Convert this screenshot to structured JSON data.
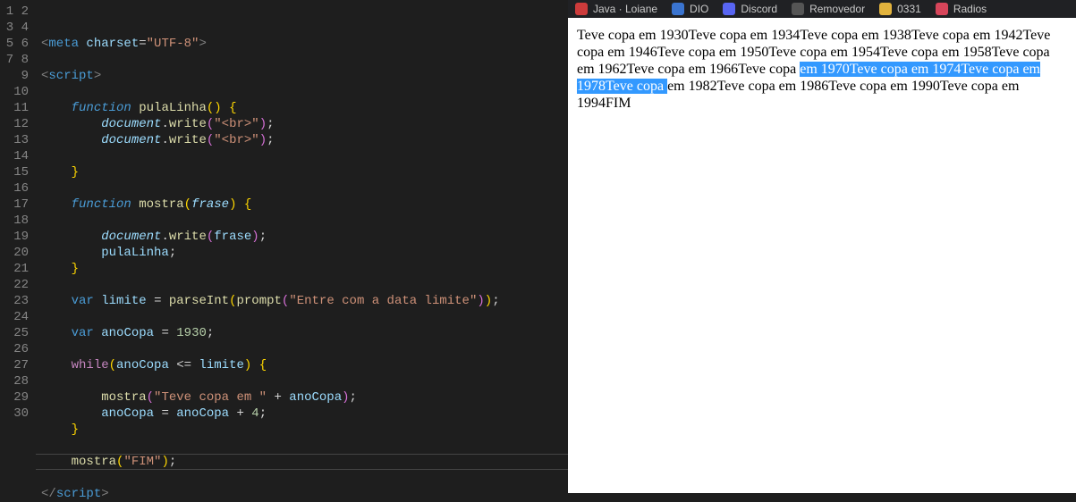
{
  "editor": {
    "line_count": 30,
    "current_line": 29,
    "lines": {
      "l1_meta": "meta",
      "l1_charset": "charset",
      "l1_val": "\"UTF-8\"",
      "l3_script": "script",
      "l5_function": "function",
      "l5_name": "pulaLinha",
      "l6_document": "document",
      "l6_write": "write",
      "l6_str": "\"<br>\"",
      "l7_document": "document",
      "l7_write": "write",
      "l7_str": "\"<br>\"",
      "l11_function": "function",
      "l11_name": "mostra",
      "l11_param": "frase",
      "l13_document": "document",
      "l13_write": "write",
      "l13_arg": "frase",
      "l14_call": "pulaLinha",
      "l17_var": "var",
      "l17_limite": "limite",
      "l17_parseInt": "parseInt",
      "l17_prompt": "prompt",
      "l17_str": "\"Entre com a data limite\"",
      "l19_var": "var",
      "l19_anoCopa": "anoCopa",
      "l19_val": "1930",
      "l21_while": "while",
      "l21_anoCopa": "anoCopa",
      "l21_limite": "limite",
      "l23_mostra": "mostra",
      "l23_str": "\"Teve copa em \"",
      "l23_anoCopa": "anoCopa",
      "l24_anoCopa": "anoCopa",
      "l24_anoCopa2": "anoCopa",
      "l24_inc": "4",
      "l27_mostra": "mostra",
      "l27_str": "\"FIM\"",
      "l29_script": "script"
    }
  },
  "bookmarks": {
    "b1": "Java · Loiane",
    "c1": "#cc3b3b",
    "b2": "DIO",
    "c2": "#3a74d0",
    "b3": "Discord",
    "c3": "#5865f2",
    "b4": "Removedor",
    "c4": "#555",
    "b5": "0331",
    "c5": "#e2b33d",
    "b6": "Radios",
    "c6": "#d6455a"
  },
  "output": {
    "pre1": "Teve copa em 1930Teve copa em 1934Teve copa em 1938Teve copa em 1942Teve copa em 1946Teve copa em 1950Teve copa em 1954Teve copa em 1958Teve copa em 1962Teve copa em 1966Teve copa ",
    "sel": "em 1970Teve copa em 1974Teve copa em 1978Teve copa ",
    "post": "em 1982Teve copa em 1986Teve copa em 1990Teve copa em 1994FIM"
  }
}
